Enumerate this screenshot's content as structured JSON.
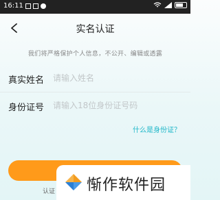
{
  "status_bar": {
    "time": "16:11"
  },
  "nav": {
    "title": "实名认证"
  },
  "privacy_note": "我们将严格保护个人信息，不公开、编辑或透露",
  "form": {
    "name": {
      "label": "真实姓名",
      "placeholder": "请输入姓名"
    },
    "id_number": {
      "label": "身份证号",
      "placeholder": "请输入18位身份证号码"
    }
  },
  "help_link": "什么是身份证？",
  "footer_text": "认证",
  "watermark": {
    "text": "惭作软件园"
  },
  "colors": {
    "accent": "#1bb6c8",
    "button": "#ff9a1a",
    "logo_orange": "#f39c1f",
    "logo_blue": "#2a7fd6"
  }
}
